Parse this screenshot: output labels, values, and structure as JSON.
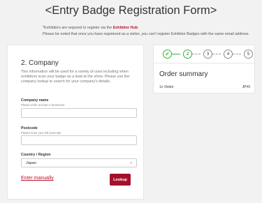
{
  "header": {
    "title": "<Entry Badge Registration Form>"
  },
  "notice": {
    "line1_prefix": "*Exhibitors are required to register via the ",
    "line1_link": "Exhibitor Hub",
    "line1_suffix": ".",
    "line2": "Please be noted that once you have registered as a visitor, you can't register Exhibitor Badges with the same email address."
  },
  "form": {
    "step_title": "2. Company",
    "description": "This information will be used for a variety of uses including when exhibitors scan your badge as a lead at the show. Please use the company lookup to search for your company's details.",
    "company_name": {
      "label": "Company name",
      "hint": "Please enter at least 3 characters",
      "value": "",
      "placeholder": ""
    },
    "postcode": {
      "label": "Postcode",
      "hint": "Please enter your full postcode",
      "value": "",
      "placeholder": ""
    },
    "country": {
      "label": "Country / Region",
      "selected": "Japan"
    },
    "manual_link": "Enter manually",
    "lookup_button": "Lookup"
  },
  "stepper": {
    "steps": [
      "✓",
      "2",
      "3",
      "4",
      "5"
    ],
    "completed": 1,
    "current": 2,
    "accent_color": "#2db52d"
  },
  "order_summary": {
    "title": "Order summary",
    "item": "1x Visitor",
    "country": "JP#0"
  },
  "colors": {
    "brand": "#b8112e",
    "button": "#a5112c",
    "background": "#f2f2f2"
  }
}
